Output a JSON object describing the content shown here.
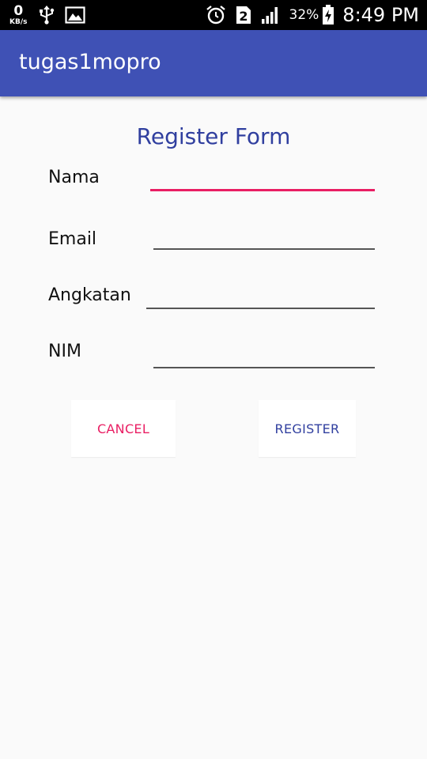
{
  "status_bar": {
    "net_speed_value": "0",
    "net_speed_unit": "KB/s",
    "icons": [
      "usb-icon",
      "image-icon",
      "alarm-icon",
      "sim-2-icon",
      "signal-icon",
      "battery-charging-icon"
    ],
    "battery_percent": "32%",
    "time": "8:49 PM"
  },
  "app_bar": {
    "title": "tugas1mopro",
    "color": "#3f51b5"
  },
  "form": {
    "title": "Register Form",
    "fields": [
      {
        "label": "Nama",
        "value": "",
        "focused": true
      },
      {
        "label": "Email",
        "value": "",
        "focused": false
      },
      {
        "label": "Angkatan",
        "value": "",
        "focused": false
      },
      {
        "label": "NIM",
        "value": "",
        "focused": false
      }
    ],
    "cancel_label": "CANCEL",
    "register_label": "REGISTER"
  },
  "colors": {
    "accent": "#e91e63",
    "primary_dark": "#303f9f"
  }
}
